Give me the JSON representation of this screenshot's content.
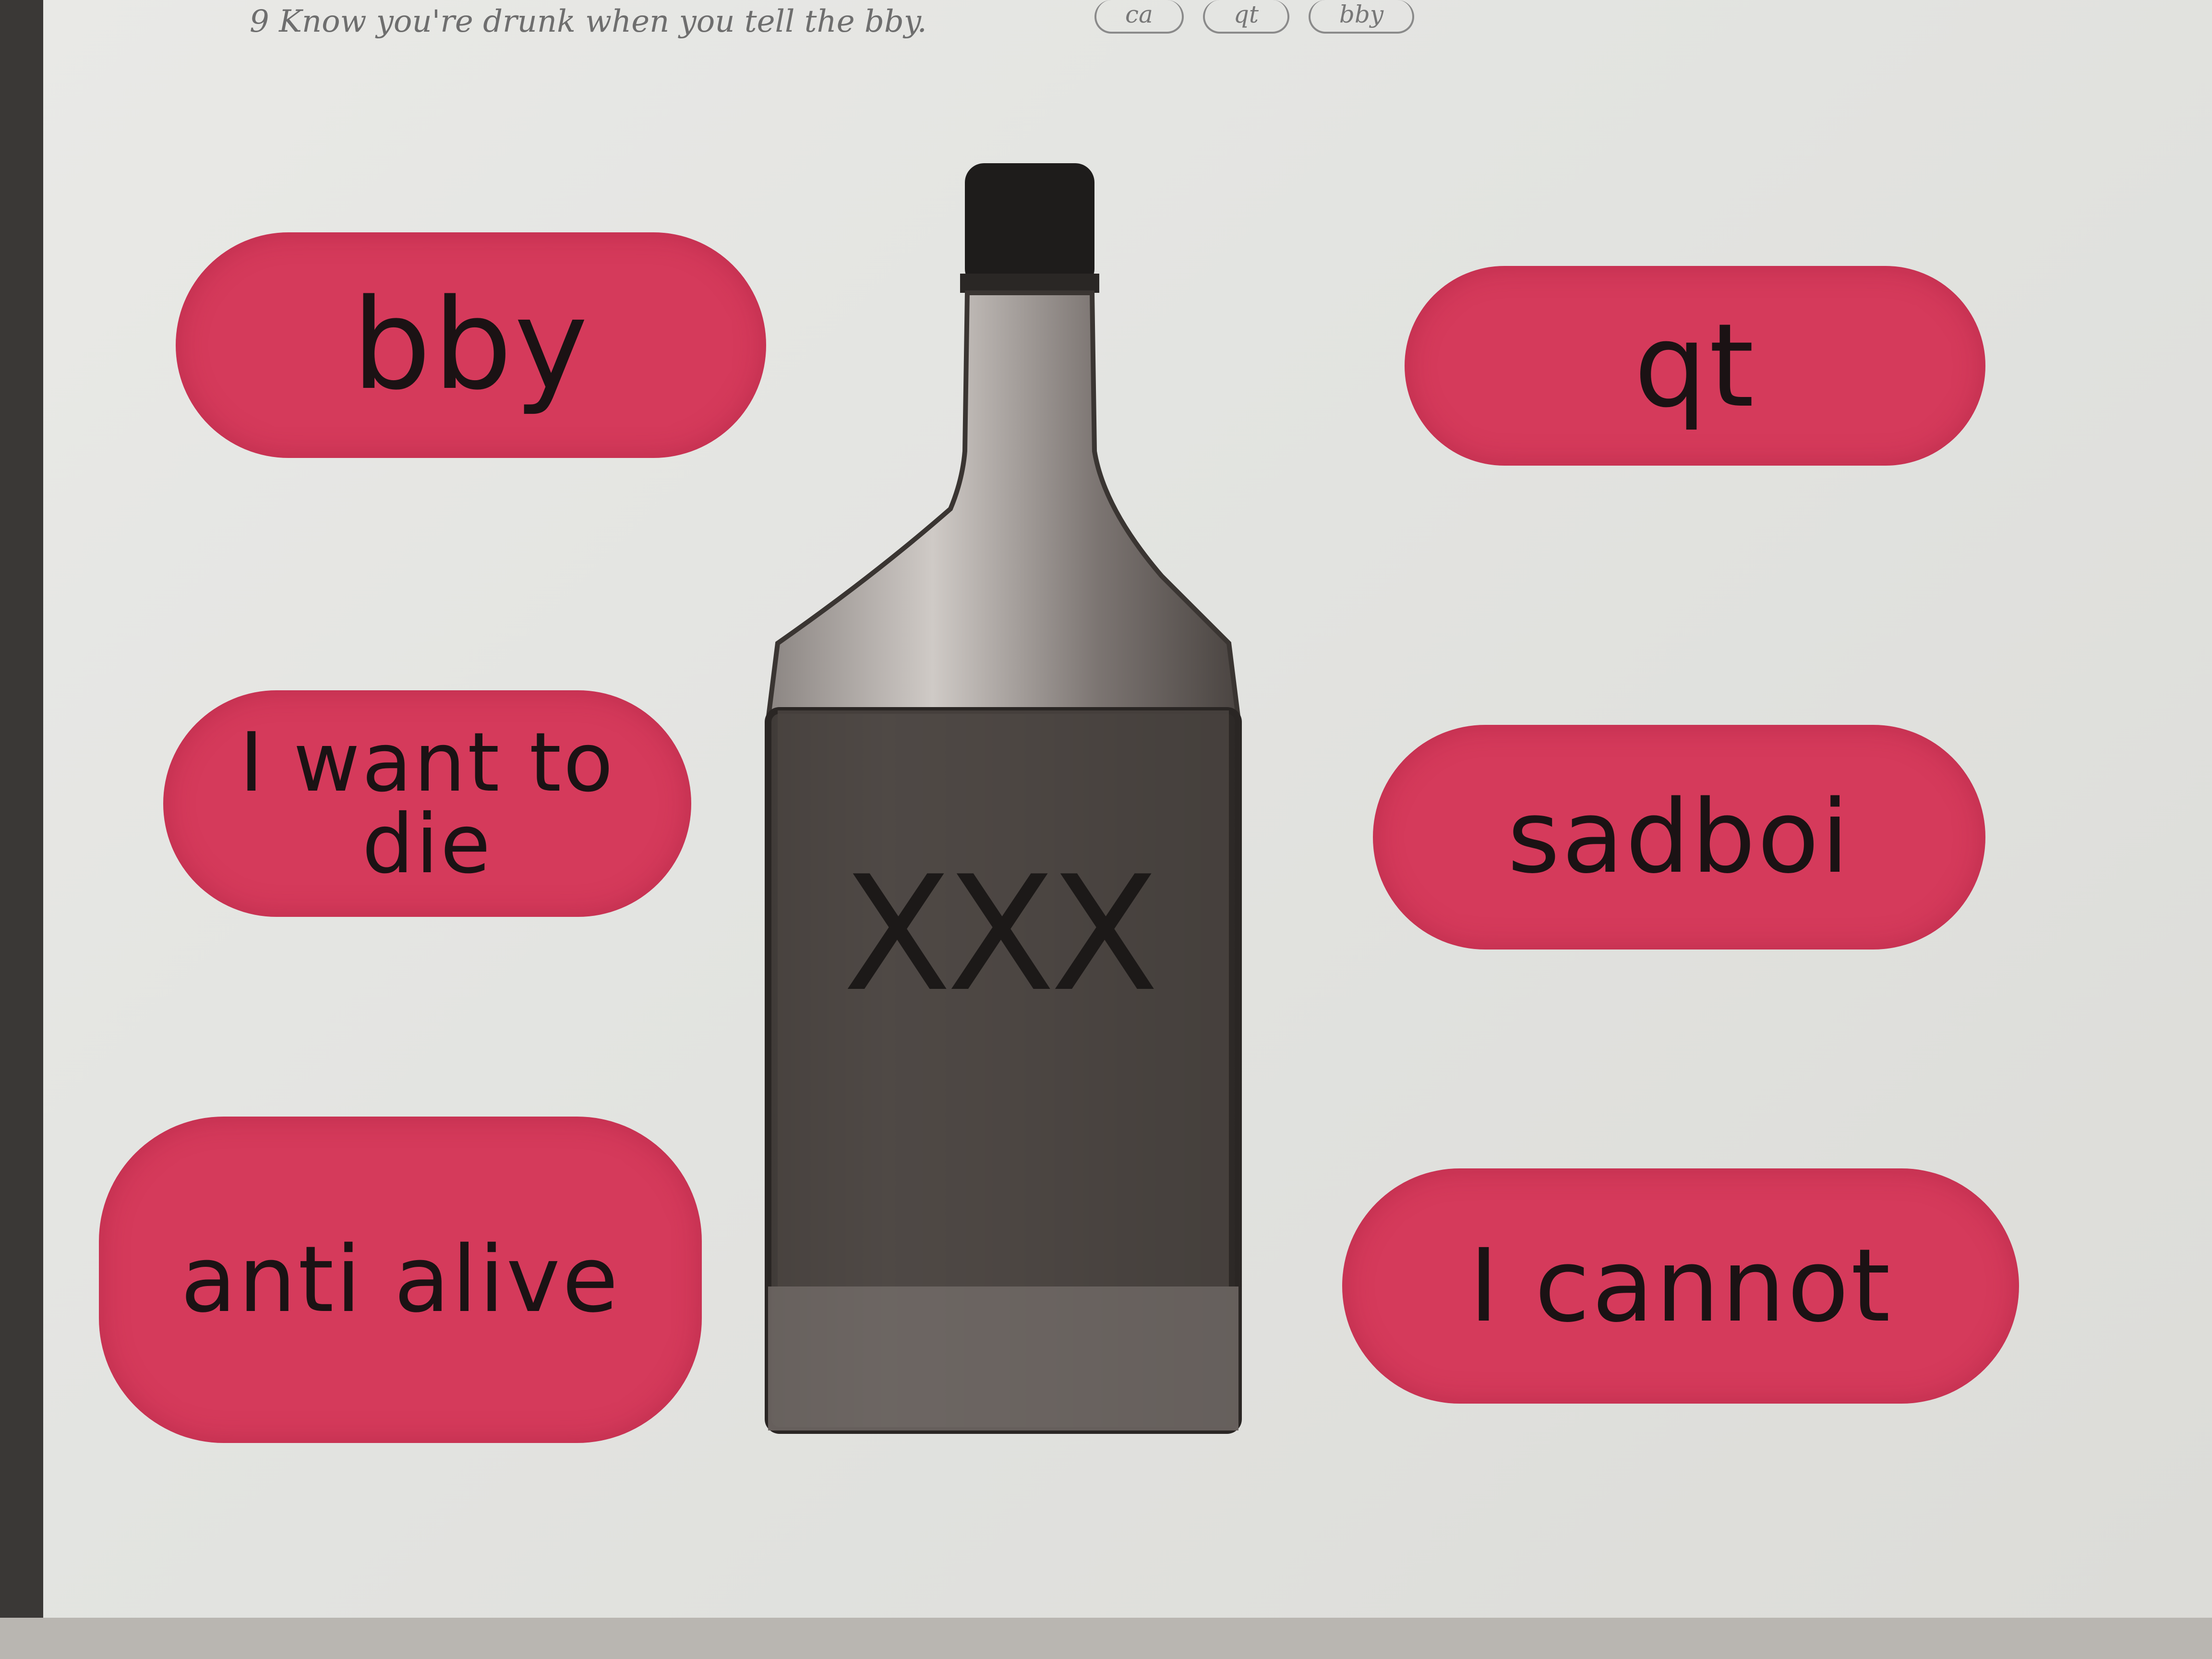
{
  "sketch_note": "9 Know you're drunk when you tell the bby.",
  "sketch_ovals": [
    "ca",
    "qt",
    "bby"
  ],
  "labels": {
    "bby": "bby",
    "qt": "qt",
    "want_to_die": "I want to die",
    "sadboi": "sadboi",
    "anti_alive": "anti alive",
    "i_cannot": "I cannot"
  },
  "bottle_label": "XXX",
  "colors": {
    "pill": "#d53a5b",
    "bottle": "#4a4441",
    "cap": "#1e1c1b",
    "paper": "#e4e5e2"
  }
}
